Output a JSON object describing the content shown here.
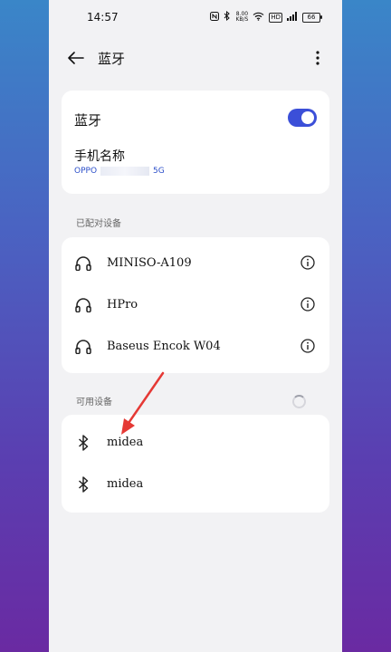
{
  "status_bar": {
    "time": "14:57",
    "net_speed_value": "8.00",
    "net_speed_unit": "KB/S",
    "hd_badge": "HD",
    "battery": "66"
  },
  "header": {
    "title": "蓝牙"
  },
  "bluetooth_card": {
    "label": "蓝牙",
    "enabled": true,
    "device_name_label": "手机名称",
    "device_name_prefix": "OPPO",
    "device_name_suffix": "5G"
  },
  "paired_section": {
    "title": "已配对设备",
    "devices": [
      {
        "name": "MINISO-A109"
      },
      {
        "name": "HPro"
      },
      {
        "name": "Baseus Encok W04"
      }
    ]
  },
  "available_section": {
    "title": "可用设备",
    "devices": [
      {
        "name": "midea"
      },
      {
        "name": "midea"
      }
    ]
  },
  "colors": {
    "accent": "#3b4fd8",
    "annotation_arrow": "#e53935"
  }
}
